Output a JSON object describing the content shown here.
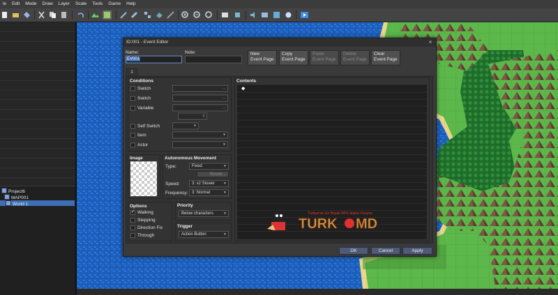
{
  "menu": [
    "le",
    "Edit",
    "Mode",
    "Draw",
    "Layer",
    "Scale",
    "Tools",
    "Game",
    "Help"
  ],
  "toolbar_icons": [
    "new-icon",
    "open-icon",
    "save-icon",
    "cut-icon",
    "copy-icon",
    "paste-icon",
    "delete-icon",
    "undo-icon",
    "map-layer-icon",
    "event-layer-icon",
    "pencil-icon",
    "rectangle-icon",
    "ellipse-icon",
    "fill-icon",
    "shadow-pen-icon",
    "zoom-in-icon",
    "zoom-out-icon",
    "zoom-reset-icon",
    "database-icon",
    "plugin-icon",
    "sound-test-icon",
    "event-search-icon",
    "resource-manager-icon",
    "playtest-icon"
  ],
  "project_tree": [
    {
      "label": "Project6",
      "level": 0
    },
    {
      "label": "MAP001",
      "level": 1
    },
    {
      "label": "World 1",
      "level": 1,
      "selected": true
    }
  ],
  "dialog": {
    "title": "ID:001 - Event Editor",
    "close": "×",
    "name_label": "Name:",
    "name_value": "EV001",
    "note_label": "Note:",
    "note_value": "",
    "buttons": {
      "new": "New\nEvent Page",
      "copy": "Copy\nEvent Page",
      "paste": "Paste\nEvent Page",
      "delete": "Delete\nEvent Page",
      "clear": "Clear\nEvent Page"
    },
    "page_tab": "1",
    "conditions": {
      "title": "Conditions",
      "switch1": "Switch",
      "switch2": "Switch",
      "variable": "Variable",
      "self_switch": "Self Switch",
      "item": "Item",
      "actor": "Actor"
    },
    "image": {
      "title": "Image"
    },
    "autonomous": {
      "title": "Autonomous Movement",
      "type_label": "Type:",
      "type_value": "Fixed",
      "route_button": "Route...",
      "speed_label": "Speed:",
      "speed_value": "3: x2 Slower",
      "freq_label": "Frequency:",
      "freq_value": "3: Normal"
    },
    "options": {
      "title": "Options",
      "walking": "Walking",
      "walking_checked": true,
      "stepping": "Stepping",
      "direction_fix": "Direction Fix",
      "through": "Through"
    },
    "priority": {
      "title": "Priority",
      "value": "Below characters"
    },
    "trigger": {
      "title": "Trigger",
      "value": "Action Button"
    },
    "contents": {
      "title": "Contents",
      "first_line": "◆"
    },
    "ok": "OK",
    "cancel": "Cancel",
    "apply": "Apply"
  },
  "watermark": {
    "logo_text": "TURKOMD",
    "tagline": "Türkiye'nin En Büyük RPG Maker Forumu"
  },
  "colors": {
    "sea": "#1b5fbf",
    "grass": "#5cb84a",
    "sand": "#e8d68a",
    "mountain": "#7a5a44",
    "forest": "#1e6b2a"
  }
}
